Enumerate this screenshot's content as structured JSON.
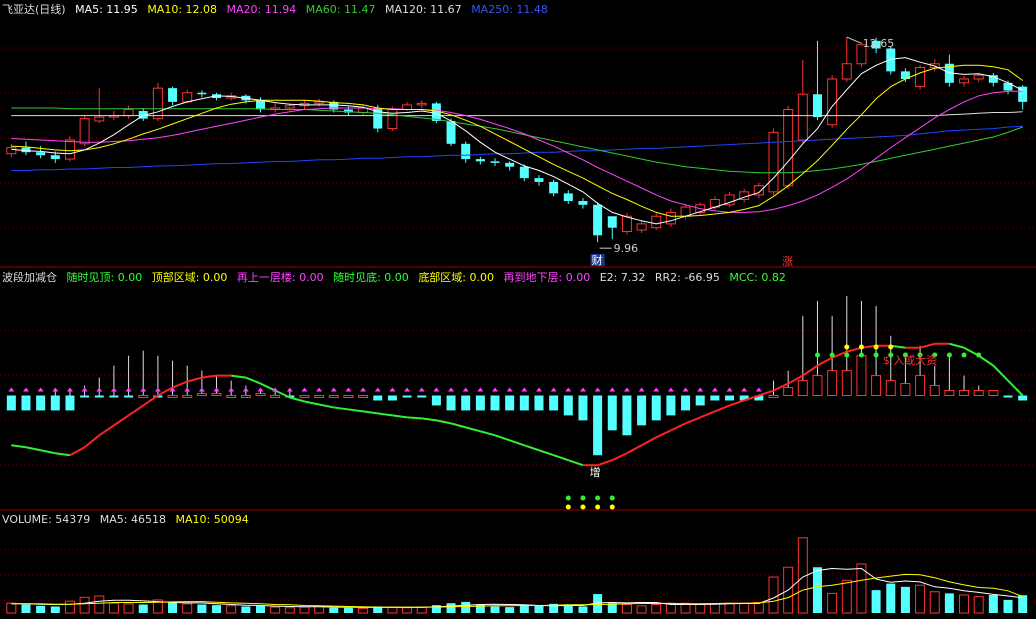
{
  "colors": {
    "up": "#ff3333",
    "down": "#54ffff",
    "ma5": "#ffffff",
    "ma10": "#ffff00",
    "ma20": "#ff44ff",
    "ma60": "#33cc33",
    "ma120": "#dddddd",
    "ma250": "#2244ff",
    "grid": "#7a0000",
    "text": "#cccccc"
  },
  "price_panel": {
    "title": "飞亚达(日线)",
    "indicators": [
      {
        "label": "MA5: 11.95",
        "color": "#ffffff"
      },
      {
        "label": "MA10: 12.08",
        "color": "#ffff00"
      },
      {
        "label": "MA20: 11.94",
        "color": "#ff44ff"
      },
      {
        "label": "MA60: 11.47",
        "color": "#33cc33"
      },
      {
        "label": "MA120: 11.67",
        "color": "#dddddd"
      },
      {
        "label": "MA250: 11.48",
        "color": "#3355ff"
      }
    ],
    "high_label": "12.65",
    "low_label": "9.96",
    "tag_cai": "财",
    "tag_zhang": "涨"
  },
  "indicator_panel": {
    "title": "波段加减仓",
    "indicators": [
      {
        "label": "随时见顶: 0.00",
        "color": "#33ff33"
      },
      {
        "label": "顶部区域: 0.00",
        "color": "#ffff00"
      },
      {
        "label": "再上一层楼: 0.00",
        "color": "#ff44ff"
      },
      {
        "label": "随时见底: 0.00",
        "color": "#33ff33"
      },
      {
        "label": "底部区域: 0.00",
        "color": "#ffff00"
      },
      {
        "label": "再到地下层: 0.00",
        "color": "#ff44ff"
      },
      {
        "label": "E2: 7.32",
        "color": "#dddddd"
      },
      {
        "label": "RR2: -66.95",
        "color": "#dddddd"
      },
      {
        "label": "MCC: 0.82",
        "color": "#33ff33"
      }
    ],
    "label_zeng": "增",
    "label_zhuang": "$ 入或大资"
  },
  "volume_panel": {
    "indicators": [
      {
        "label": "VOLUME: 54379",
        "color": "#dddddd"
      },
      {
        "label": "MA5: 46518",
        "color": "#dddddd"
      },
      {
        "label": "MA10: 50094",
        "color": "#ffff00"
      }
    ]
  },
  "chart_data": {
    "type": "candlestick",
    "open": [
      11.12,
      11.2,
      11.14,
      11.1,
      11.05,
      11.25,
      11.55,
      11.6,
      11.62,
      11.68,
      11.58,
      11.98,
      11.8,
      11.92,
      11.9,
      11.85,
      11.88,
      11.82,
      11.7,
      11.72,
      11.75,
      11.78,
      11.8,
      11.7,
      11.66,
      11.72,
      11.45,
      11.7,
      11.76,
      11.78,
      11.55,
      11.25,
      11.05,
      11.02,
      11.0,
      10.95,
      10.8,
      10.75,
      10.6,
      10.5,
      10.45,
      10.3,
      10.1,
      10.12,
      10.15,
      10.2,
      10.3,
      10.35,
      10.42,
      10.45,
      10.52,
      10.58,
      10.62,
      10.7,
      11.3,
      11.9,
      11.5,
      12.1,
      12.3,
      12.6,
      12.5,
      12.2,
      12.0,
      12.25,
      12.3,
      12.05,
      12.1,
      12.15,
      12.05,
      12.0
    ],
    "close": [
      11.2,
      11.14,
      11.1,
      11.05,
      11.3,
      11.58,
      11.6,
      11.62,
      11.7,
      11.58,
      11.98,
      11.8,
      11.92,
      11.9,
      11.85,
      11.88,
      11.82,
      11.7,
      11.72,
      11.75,
      11.78,
      11.8,
      11.7,
      11.66,
      11.72,
      11.45,
      11.7,
      11.76,
      11.78,
      11.55,
      11.25,
      11.05,
      11.02,
      11.0,
      10.95,
      10.8,
      10.75,
      10.6,
      10.5,
      10.45,
      10.05,
      10.15,
      10.3,
      10.2,
      10.3,
      10.35,
      10.42,
      10.45,
      10.52,
      10.58,
      10.62,
      10.7,
      11.4,
      11.7,
      11.9,
      11.6,
      12.1,
      12.3,
      12.55,
      12.5,
      12.2,
      12.1,
      12.25,
      12.3,
      12.05,
      12.1,
      12.15,
      12.05,
      11.95,
      11.8
    ],
    "high": [
      11.25,
      11.28,
      11.22,
      11.15,
      11.35,
      11.62,
      11.98,
      11.68,
      11.75,
      11.72,
      12.05,
      12.0,
      11.96,
      11.95,
      11.92,
      11.92,
      11.9,
      11.86,
      11.78,
      11.78,
      11.82,
      11.84,
      11.82,
      11.74,
      11.76,
      11.76,
      11.74,
      11.8,
      11.82,
      11.8,
      11.58,
      11.28,
      11.08,
      11.06,
      11.02,
      10.98,
      10.84,
      10.78,
      10.64,
      10.54,
      10.48,
      10.22,
      10.34,
      10.24,
      10.34,
      10.4,
      10.46,
      10.48,
      10.56,
      10.62,
      10.66,
      10.74,
      11.45,
      11.75,
      12.35,
      12.6,
      12.15,
      12.65,
      12.58,
      12.64,
      12.52,
      12.24,
      12.28,
      12.36,
      12.42,
      12.14,
      12.18,
      12.18,
      12.08,
      12.02
    ],
    "low": [
      11.08,
      11.1,
      11.06,
      11.0,
      11.02,
      11.22,
      11.52,
      11.56,
      11.58,
      11.55,
      11.55,
      11.76,
      11.78,
      11.86,
      11.82,
      11.82,
      11.78,
      11.66,
      11.66,
      11.68,
      11.7,
      11.74,
      11.66,
      11.62,
      11.62,
      11.4,
      11.42,
      11.68,
      11.72,
      11.52,
      11.22,
      11.0,
      10.98,
      10.96,
      10.9,
      10.76,
      10.7,
      10.56,
      10.46,
      10.4,
      9.96,
      10.0,
      10.06,
      10.08,
      10.12,
      10.16,
      10.26,
      10.32,
      10.38,
      10.42,
      10.48,
      10.54,
      10.58,
      10.66,
      11.26,
      11.56,
      11.46,
      12.06,
      12.26,
      12.44,
      12.16,
      12.06,
      11.96,
      12.2,
      12.0,
      12.0,
      12.06,
      12.0,
      11.9,
      11.7
    ],
    "ma5": [
      11.18,
      11.16,
      11.15,
      11.13,
      11.12,
      11.17,
      11.26,
      11.37,
      11.5,
      11.62,
      11.67,
      11.74,
      11.8,
      11.84,
      11.88,
      11.87,
      11.85,
      11.82,
      11.79,
      11.77,
      11.76,
      11.76,
      11.76,
      11.75,
      11.73,
      11.67,
      11.65,
      11.66,
      11.68,
      11.65,
      11.55,
      11.42,
      11.27,
      11.14,
      11.05,
      10.96,
      10.9,
      10.82,
      10.72,
      10.62,
      10.47,
      10.35,
      10.29,
      10.24,
      10.2,
      10.24,
      10.3,
      10.36,
      10.42,
      10.48,
      10.55,
      10.61,
      10.8,
      11.02,
      11.25,
      11.45,
      11.74,
      11.96,
      12.17,
      12.28,
      12.36,
      12.38,
      12.32,
      12.27,
      12.18,
      12.16,
      12.17,
      12.13,
      12.05,
      11.95
    ],
    "ma10": [
      11.22,
      11.21,
      11.19,
      11.17,
      11.16,
      11.17,
      11.2,
      11.25,
      11.31,
      11.38,
      11.44,
      11.51,
      11.58,
      11.65,
      11.72,
      11.77,
      11.8,
      11.82,
      11.82,
      11.82,
      11.82,
      11.81,
      11.79,
      11.78,
      11.76,
      11.72,
      11.7,
      11.7,
      11.7,
      11.68,
      11.63,
      11.56,
      11.48,
      11.38,
      11.28,
      11.18,
      11.08,
      10.98,
      10.89,
      10.8,
      10.7,
      10.6,
      10.52,
      10.43,
      10.35,
      10.3,
      10.3,
      10.31,
      10.33,
      10.35,
      10.39,
      10.44,
      10.56,
      10.7,
      10.86,
      11.03,
      11.23,
      11.44,
      11.63,
      11.84,
      12.0,
      12.1,
      12.18,
      12.24,
      12.26,
      12.28,
      12.28,
      12.26,
      12.22,
      12.08
    ],
    "ma20": [
      11.32,
      11.31,
      11.3,
      11.29,
      11.28,
      11.27,
      11.27,
      11.28,
      11.29,
      11.31,
      11.33,
      11.36,
      11.4,
      11.44,
      11.48,
      11.52,
      11.56,
      11.6,
      11.64,
      11.67,
      11.7,
      11.71,
      11.72,
      11.72,
      11.72,
      11.71,
      11.71,
      11.7,
      11.7,
      11.69,
      11.66,
      11.62,
      11.57,
      11.51,
      11.45,
      11.38,
      11.3,
      11.22,
      11.13,
      11.04,
      10.94,
      10.85,
      10.76,
      10.67,
      10.58,
      10.5,
      10.45,
      10.4,
      10.37,
      10.35,
      10.35,
      10.36,
      10.39,
      10.44,
      10.5,
      10.58,
      10.68,
      10.79,
      10.92,
      11.06,
      11.2,
      11.33,
      11.46,
      11.59,
      11.7,
      11.8,
      11.88,
      11.92,
      11.94,
      11.94
    ],
    "ma60": [
      11.72,
      11.72,
      11.72,
      11.72,
      11.71,
      11.71,
      11.71,
      11.71,
      11.71,
      11.71,
      11.71,
      11.71,
      11.71,
      11.71,
      11.71,
      11.71,
      11.71,
      11.71,
      11.7,
      11.7,
      11.7,
      11.69,
      11.68,
      11.67,
      11.66,
      11.65,
      11.63,
      11.61,
      11.59,
      11.57,
      11.54,
      11.51,
      11.48,
      11.45,
      11.41,
      11.37,
      11.33,
      11.29,
      11.25,
      11.21,
      11.17,
      11.13,
      11.09,
      11.05,
      11.01,
      10.98,
      10.95,
      10.93,
      10.91,
      10.89,
      10.88,
      10.87,
      10.87,
      10.87,
      10.88,
      10.9,
      10.92,
      10.95,
      10.98,
      11.02,
      11.06,
      11.1,
      11.14,
      11.18,
      11.22,
      11.26,
      11.3,
      11.34,
      11.4,
      11.47
    ],
    "ma120": [
      11.62,
      11.62,
      11.62,
      11.62,
      11.62,
      11.62,
      11.62,
      11.62,
      11.62,
      11.62,
      11.62,
      11.62,
      11.62,
      11.62,
      11.62,
      11.62,
      11.62,
      11.62,
      11.62,
      11.62,
      11.62,
      11.62,
      11.62,
      11.62,
      11.62,
      11.62,
      11.62,
      11.62,
      11.62,
      11.62,
      11.62,
      11.62,
      11.62,
      11.62,
      11.62,
      11.62,
      11.62,
      11.62,
      11.62,
      11.62,
      11.62,
      11.62,
      11.62,
      11.62,
      11.62,
      11.62,
      11.62,
      11.62,
      11.62,
      11.62,
      11.62,
      11.62,
      11.62,
      11.62,
      11.62,
      11.62,
      11.62,
      11.62,
      11.62,
      11.62,
      11.62,
      11.62,
      11.62,
      11.62,
      11.63,
      11.64,
      11.65,
      11.66,
      11.66,
      11.67
    ],
    "ma250": [
      10.9,
      10.9,
      10.91,
      10.91,
      10.92,
      10.92,
      10.93,
      10.94,
      10.94,
      10.95,
      10.96,
      10.96,
      10.97,
      10.98,
      10.99,
      10.99,
      11.0,
      11.01,
      11.02,
      11.02,
      11.03,
      11.04,
      11.04,
      11.05,
      11.06,
      11.06,
      11.07,
      11.08,
      11.08,
      11.09,
      11.1,
      11.1,
      11.11,
      11.12,
      11.12,
      11.13,
      11.14,
      11.14,
      11.15,
      11.16,
      11.16,
      11.17,
      11.18,
      11.19,
      11.19,
      11.2,
      11.21,
      11.22,
      11.23,
      11.24,
      11.25,
      11.26,
      11.27,
      11.28,
      11.29,
      11.3,
      11.31,
      11.32,
      11.33,
      11.34,
      11.35,
      11.36,
      11.38,
      11.4,
      11.42,
      11.43,
      11.44,
      11.45,
      11.47,
      11.48
    ],
    "volume": [
      30000,
      26000,
      22000,
      20000,
      36000,
      48000,
      52000,
      30000,
      28000,
      26000,
      40000,
      34000,
      28000,
      26000,
      24000,
      22000,
      20000,
      22000,
      18000,
      16000,
      18000,
      20000,
      16000,
      16000,
      14000,
      20000,
      18000,
      16000,
      18000,
      24000,
      30000,
      34000,
      26000,
      20000,
      18000,
      22000,
      24000,
      28000,
      22000,
      20000,
      58000,
      30000,
      26000,
      22000,
      26000,
      28000,
      30000,
      26000,
      28000,
      30000,
      30000,
      32000,
      110000,
      140000,
      230000,
      140000,
      60000,
      100000,
      150000,
      70000,
      90000,
      80000,
      85000,
      65000,
      60000,
      55000,
      50000,
      55000,
      40000,
      54379
    ],
    "vol_ma5": [
      28000,
      28000,
      27000,
      26000,
      27000,
      30000,
      36000,
      39000,
      39000,
      37000,
      35000,
      32000,
      31000,
      31000,
      28000,
      26000,
      24000,
      23000,
      21000,
      20000,
      19000,
      19000,
      18000,
      18000,
      17000,
      17000,
      17000,
      17000,
      17000,
      19000,
      21000,
      24000,
      26000,
      27000,
      26000,
      25000,
      23000,
      22000,
      23000,
      23000,
      31000,
      32000,
      31000,
      32000,
      32000,
      26000,
      26000,
      26000,
      27000,
      28000,
      29000,
      29000,
      46000,
      70000,
      110000,
      130000,
      136000,
      134000,
      136000,
      104000,
      94000,
      98000,
      95000,
      80000,
      76000,
      68000,
      63000,
      57000,
      52000,
      46518
    ],
    "vol_ma10": [
      28000,
      28000,
      28000,
      27000,
      27000,
      28000,
      30000,
      32000,
      32000,
      32000,
      33000,
      34000,
      35000,
      35000,
      33000,
      31000,
      30000,
      28000,
      26000,
      25000,
      23000,
      22000,
      21000,
      20000,
      19000,
      18000,
      18000,
      18000,
      18000,
      18000,
      19000,
      20000,
      21000,
      22000,
      22000,
      23000,
      23000,
      24000,
      25000,
      25000,
      26000,
      27000,
      28000,
      29000,
      29000,
      30000,
      28000,
      28000,
      29000,
      30000,
      30000,
      31000,
      36000,
      47000,
      70000,
      80000,
      85000,
      92000,
      100000,
      107000,
      113000,
      118000,
      117000,
      108000,
      95000,
      86000,
      78000,
      76000,
      68000,
      50094
    ],
    "ind_mcc": [
      -0.5,
      -0.52,
      -0.55,
      -0.58,
      -0.6,
      -0.52,
      -0.4,
      -0.3,
      -0.2,
      -0.1,
      0.0,
      0.08,
      0.14,
      0.18,
      0.2,
      0.2,
      0.18,
      0.12,
      0.05,
      -0.02,
      -0.06,
      -0.09,
      -0.12,
      -0.14,
      -0.16,
      -0.18,
      -0.2,
      -0.22,
      -0.23,
      -0.25,
      -0.28,
      -0.32,
      -0.36,
      -0.4,
      -0.45,
      -0.5,
      -0.55,
      -0.6,
      -0.65,
      -0.7,
      -0.7,
      -0.65,
      -0.58,
      -0.5,
      -0.42,
      -0.35,
      -0.28,
      -0.22,
      -0.16,
      -0.1,
      -0.05,
      0.0,
      0.05,
      0.12,
      0.2,
      0.3,
      0.38,
      0.44,
      0.48,
      0.5,
      0.5,
      0.48,
      0.48,
      0.52,
      0.52,
      0.48,
      0.4,
      0.3,
      0.15,
      0.0
    ],
    "ind_body": [
      -0.15,
      -0.15,
      -0.15,
      -0.15,
      -0.15,
      -0.02,
      -0.02,
      -0.02,
      -0.02,
      0.0,
      -0.02,
      0.0,
      0.0,
      0.02,
      0.02,
      0.0,
      0.0,
      0.02,
      0.0,
      -0.02,
      0.0,
      0.0,
      0.0,
      0.0,
      0.0,
      -0.05,
      -0.05,
      -0.02,
      -0.02,
      -0.1,
      -0.15,
      -0.15,
      -0.15,
      -0.15,
      -0.15,
      -0.15,
      -0.15,
      -0.15,
      -0.2,
      -0.25,
      -0.6,
      -0.35,
      -0.4,
      -0.3,
      -0.25,
      -0.2,
      -0.15,
      -0.1,
      -0.05,
      -0.05,
      -0.05,
      -0.05,
      0.0,
      0.08,
      0.15,
      0.2,
      0.25,
      0.25,
      0.4,
      0.2,
      0.15,
      0.12,
      0.2,
      0.1,
      0.05,
      0.05,
      0.05,
      0.05,
      -0.02,
      -0.05
    ],
    "ind_wick": [
      0.0,
      0.0,
      0.0,
      0.05,
      0.05,
      0.1,
      0.18,
      0.3,
      0.4,
      0.45,
      0.4,
      0.35,
      0.3,
      0.25,
      0.2,
      0.15,
      0.1,
      0.05,
      0.05,
      0.05,
      0.0,
      0.0,
      0.0,
      0.0,
      0.0,
      0.0,
      0.0,
      0.0,
      0.0,
      0.0,
      0.0,
      0.0,
      0.0,
      0.0,
      0.0,
      0.0,
      0.0,
      0.0,
      0.0,
      0.0,
      0.0,
      0.0,
      0.0,
      0.0,
      0.0,
      0.0,
      0.0,
      0.0,
      0.0,
      0.0,
      0.0,
      0.0,
      0.15,
      0.25,
      0.8,
      0.95,
      0.8,
      1.0,
      0.95,
      0.9,
      0.6,
      0.4,
      0.5,
      0.3,
      0.4,
      0.2,
      0.1,
      0.05,
      0.0,
      0.0
    ],
    "price_ylim": [
      9.7,
      12.9
    ],
    "volume_ylim": [
      0,
      260000
    ],
    "ind_ylim": [
      -1.1,
      1.1
    ]
  }
}
